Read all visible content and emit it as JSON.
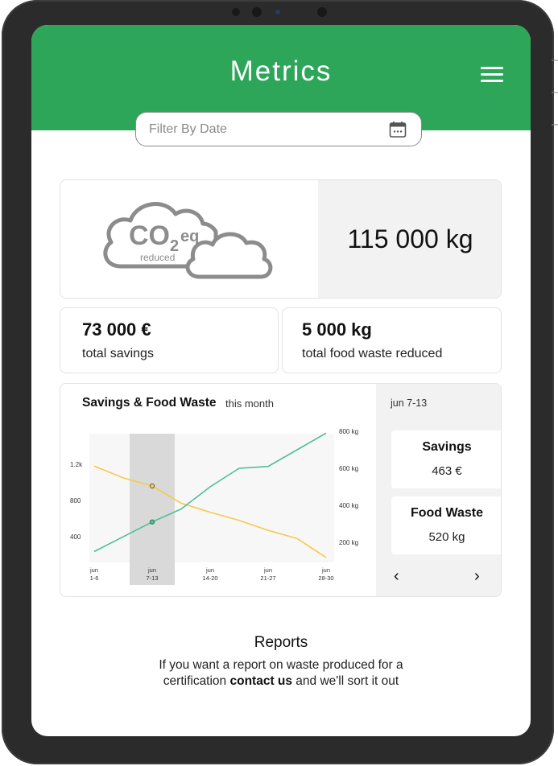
{
  "app": {
    "title": "Metrics"
  },
  "filter": {
    "placeholder": "Filter By Date"
  },
  "co2": {
    "main": "CO",
    "sub": "2",
    "eq": "eq",
    "reduced": "reduced",
    "value": "115 000 kg"
  },
  "stats": [
    {
      "value": "73 000 €",
      "label": "total savings"
    },
    {
      "value": "5 000 kg",
      "label": "total food waste reduced"
    }
  ],
  "chart_section": {
    "title": "Savings & Food Waste",
    "period": "this month",
    "side": {
      "range": "jun 7-13",
      "savings_title": "Savings",
      "savings_value": "463 €",
      "waste_title": "Food Waste",
      "waste_value": "520 kg",
      "prev": "‹",
      "next": "›"
    }
  },
  "chart_data": {
    "type": "line",
    "x_ticks": [
      {
        "top": "jun",
        "bottom": "1-6"
      },
      {
        "top": "jun",
        "bottom": "7-13"
      },
      {
        "top": "jun",
        "bottom": "14-20"
      },
      {
        "top": "jun",
        "bottom": "21-27"
      },
      {
        "top": "jun",
        "bottom": "28-30"
      }
    ],
    "left_axis": {
      "ticks": [
        "400",
        "800",
        "1.2k"
      ],
      "values": [
        400,
        800,
        1200
      ]
    },
    "right_axis": {
      "ticks": [
        "200 kg",
        "400 kg",
        "600 kg",
        "800 kg"
      ],
      "values": [
        200,
        400,
        600,
        800
      ]
    },
    "highlighted_period": "jun 7-13",
    "series": [
      {
        "axis": "left",
        "color": "#f7c948",
        "x": [
          0,
          0.5,
          1,
          1.5,
          2,
          2.5,
          3,
          3.5,
          4
        ],
        "values": [
          1180,
          1050,
          960,
          770,
          670,
          580,
          470,
          380,
          170
        ]
      },
      {
        "axis": "right",
        "color": "#4dbf94",
        "x": [
          0,
          0.5,
          1,
          1.5,
          2,
          2.5,
          3,
          3.5,
          4
        ],
        "values": [
          150,
          230,
          310,
          380,
          500,
          600,
          610,
          700,
          790
        ]
      }
    ]
  },
  "reports": {
    "title": "Reports",
    "text_before": "If you want a report on waste produced for a certification ",
    "link": "contact us",
    "text_after": " and we'll sort it out"
  }
}
